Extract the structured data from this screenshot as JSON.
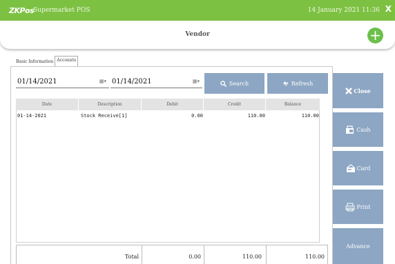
{
  "titlebar": {
    "logo": "ZKPos",
    "app_name": "Supermarket POS",
    "datetime": "14 January 2021 11:36",
    "close_label": "X"
  },
  "header": {
    "title": "Vendor",
    "add_label": "+"
  },
  "tabs": [
    {
      "label": "Basic Information"
    },
    {
      "label": "Accounts"
    }
  ],
  "filters": {
    "from_date": "01/14/2021",
    "to_date": "01/14/2021",
    "search_label": "Search",
    "refresh_label": "Refresh"
  },
  "table": {
    "columns": [
      "Date",
      "Description",
      "Debit",
      "Credit",
      "Balance"
    ],
    "rows": [
      {
        "date": "01-14-2021",
        "description": "Stock Receive[1]",
        "debit": "0.00",
        "credit": "110.00",
        "balance": "110.00"
      }
    ]
  },
  "totals": {
    "label": "Total",
    "debit": "0.00",
    "credit": "110.00",
    "balance": "110.00"
  },
  "side_buttons": {
    "close": "Close",
    "cash": "Cash",
    "card": "Card",
    "print": "Print",
    "advance": "Advance"
  },
  "colors": {
    "titlebar": "#7dc142",
    "button": "#8ca6c3",
    "add_button": "#6cc04a"
  }
}
